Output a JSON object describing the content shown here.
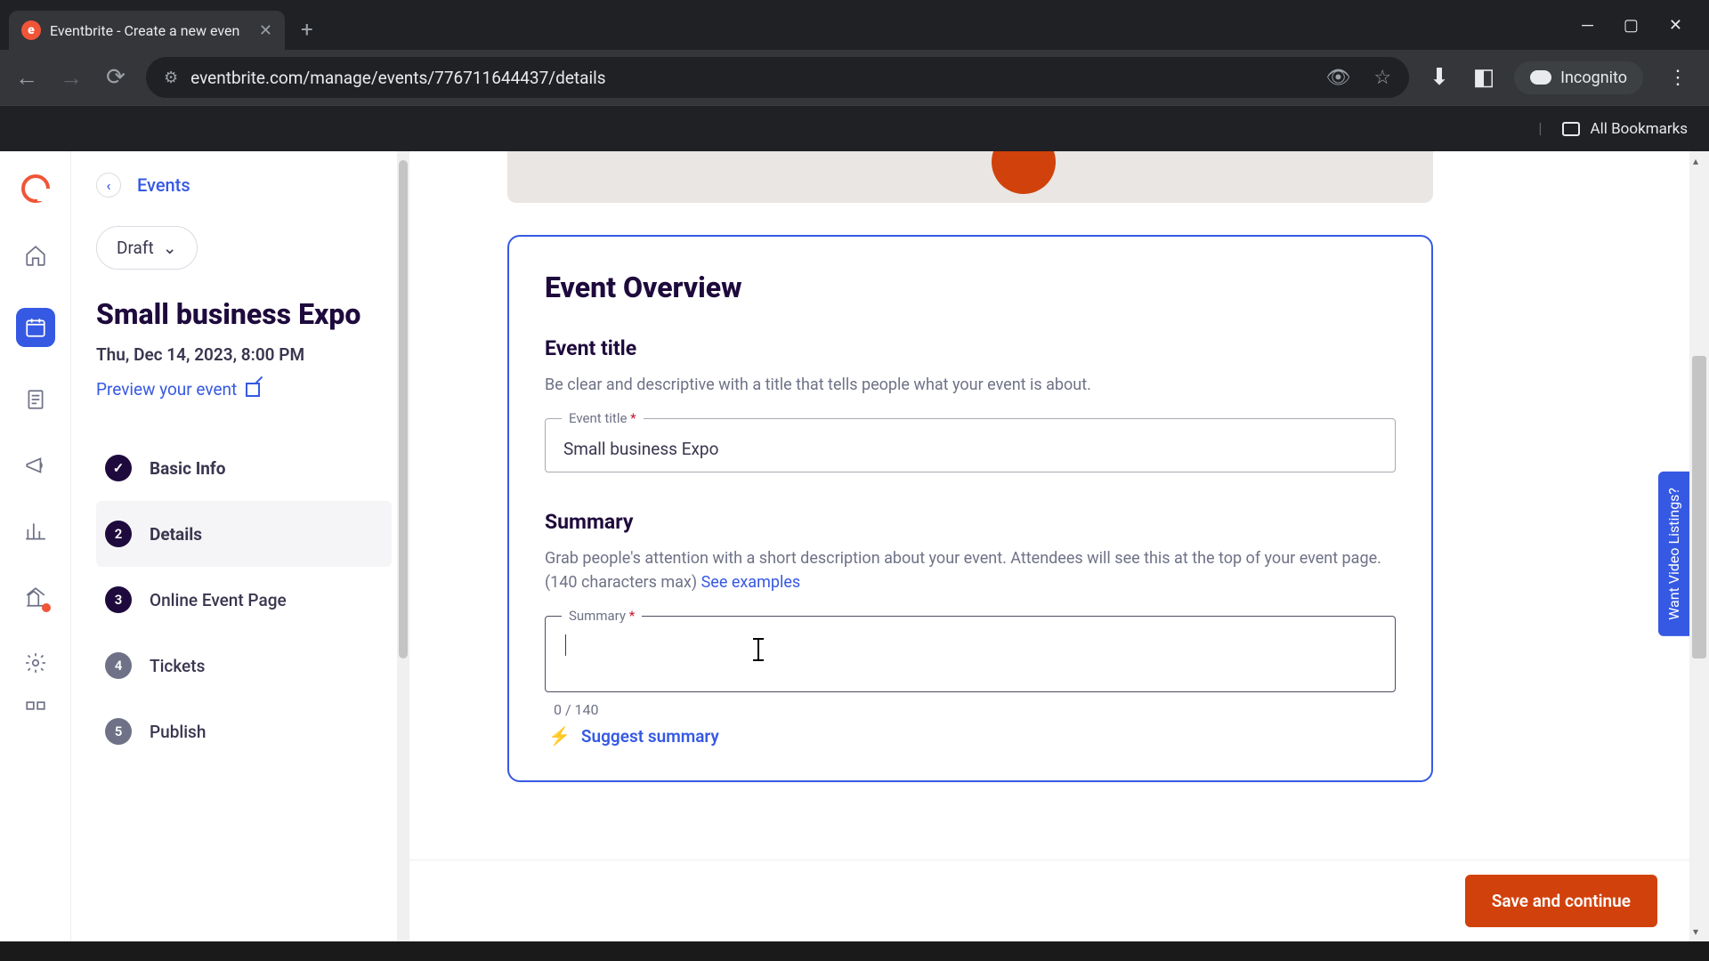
{
  "browser": {
    "tab_title": "Eventbrite - Create a new even",
    "url": "eventbrite.com/manage/events/776711644437/details",
    "incognito_label": "Incognito",
    "all_bookmarks": "All Bookmarks"
  },
  "sidebar": {
    "back_label": "Events",
    "draft_label": "Draft",
    "event_name": "Small business Expo",
    "event_date": "Thu, Dec 14, 2023, 8:00 PM",
    "preview_label": "Preview your event",
    "steps": [
      {
        "num": "",
        "label": "Basic Info",
        "done": true
      },
      {
        "num": "2",
        "label": "Details",
        "active": true
      },
      {
        "num": "3",
        "label": "Online Event Page"
      },
      {
        "num": "4",
        "label": "Tickets"
      },
      {
        "num": "5",
        "label": "Publish"
      }
    ]
  },
  "main": {
    "card_title": "Event Overview",
    "title_section": {
      "heading": "Event title",
      "desc": "Be clear and descriptive with a title that tells people what your event is about.",
      "field_label": "Event title",
      "value": "Small business Expo"
    },
    "summary_section": {
      "heading": "Summary",
      "desc": "Grab people's attention with a short description about your event. Attendees will see this at the top of your event page. (140 characters max) ",
      "see_examples": "See examples",
      "field_label": "Summary",
      "value": "",
      "char_count": "0 / 140",
      "suggest_label": "Suggest summary"
    },
    "save_label": "Save and continue"
  },
  "feedback": "Want Video Listings?"
}
